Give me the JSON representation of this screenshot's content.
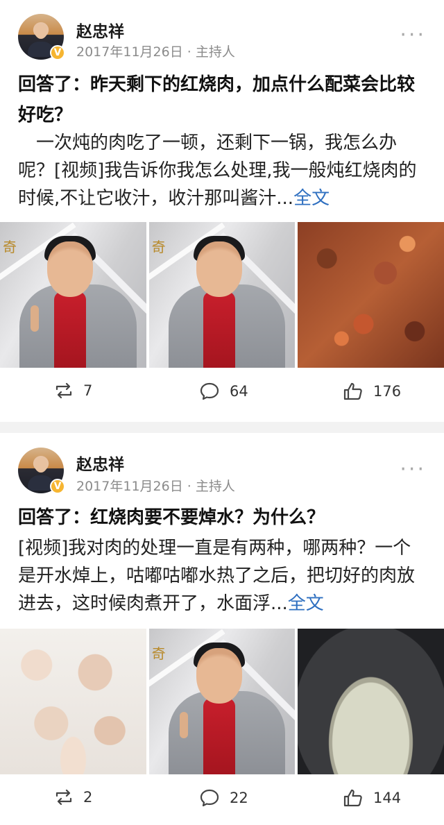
{
  "posts": [
    {
      "author": "赵忠祥",
      "meta": "2017年11月26日 · 主持人",
      "title": "回答了：昨天剩下的红烧肉，加点什么配菜会比较好吃？",
      "body": "一次炖的肉吃了一顿，还剩下一锅，我怎么办呢？[视频]我告诉你我怎么处理,我一般炖红烧肉的时候,不让它收汁，收汁那叫酱汁...",
      "more_link": "全文",
      "photos": [
        "presenter-video-frame",
        "presenter-video-frame",
        "braised-pork-with-carrots"
      ],
      "reposts": "7",
      "comments": "64",
      "likes": "176"
    },
    {
      "author": "赵忠祥",
      "meta": "2017年11月26日 · 主持人",
      "title": "回答了：红烧肉要不要焯水？为什么？",
      "body": "[视频]我对肉的处理一直是有两种，哪两种？一个是开水焯上，咕嘟咕嘟水热了之后，把切好的肉放进去，这时候肉煮开了，水面浮...",
      "more_link": "全文",
      "photos": [
        "raw-pork-cubes",
        "presenter-video-frame",
        "boiling-water-pot"
      ],
      "reposts": "2",
      "comments": "22",
      "likes": "144"
    }
  ],
  "studio_logo_text": "奇",
  "verified_badge": "V",
  "more_icon": "···",
  "colors": {
    "link": "#2e6fc0",
    "meta": "#8b8b8b",
    "badge": "#f6b531"
  }
}
